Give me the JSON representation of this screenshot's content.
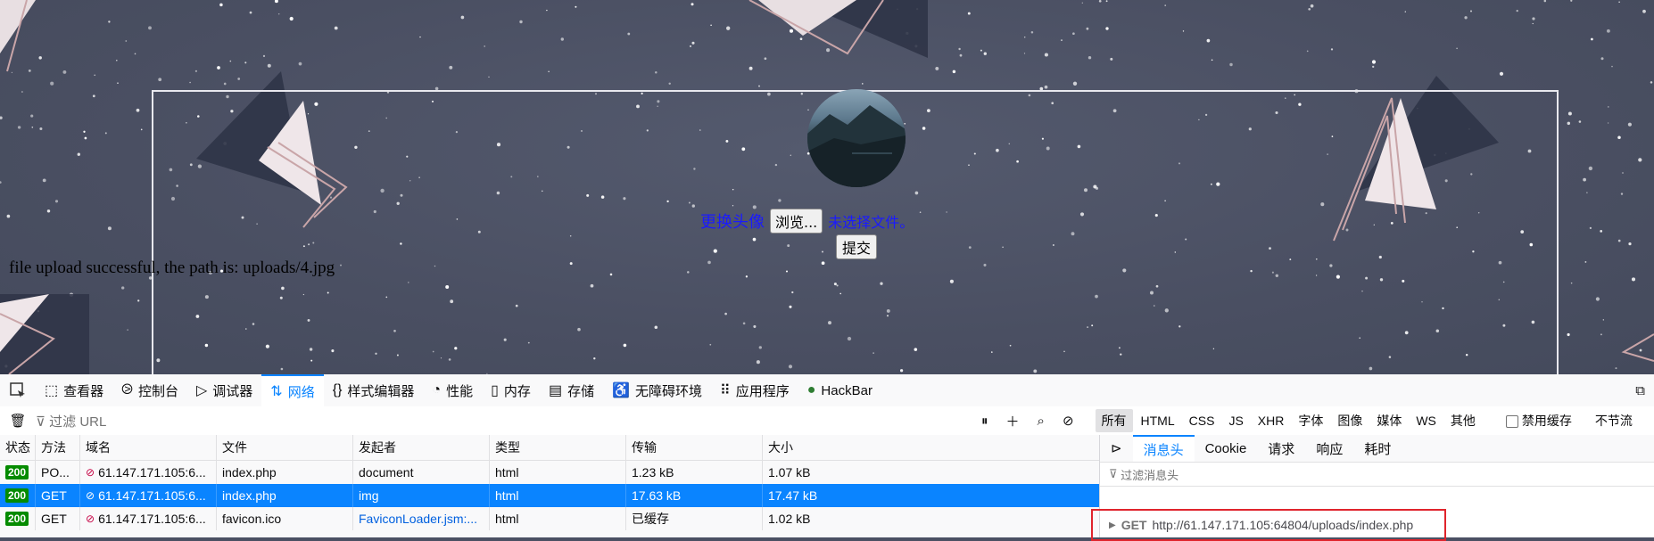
{
  "page": {
    "upload_label": "更换头像",
    "browse_button": "浏览...",
    "no_file_text": "未选择文件。",
    "submit_button": "提交",
    "status_message": "file upload successful, the path is: uploads/4.jpg"
  },
  "devtools": {
    "tabs": [
      {
        "label": "查看器",
        "icon": "inspector-icon"
      },
      {
        "label": "控制台",
        "icon": "console-icon"
      },
      {
        "label": "调试器",
        "icon": "debugger-icon"
      },
      {
        "label": "网络",
        "icon": "network-icon",
        "active": true
      },
      {
        "label": "样式编辑器",
        "icon": "style-editor-icon"
      },
      {
        "label": "性能",
        "icon": "performance-icon"
      },
      {
        "label": "内存",
        "icon": "memory-icon"
      },
      {
        "label": "存储",
        "icon": "storage-icon"
      },
      {
        "label": "无障碍环境",
        "icon": "accessibility-icon"
      },
      {
        "label": "应用程序",
        "icon": "application-icon"
      },
      {
        "label": "HackBar",
        "icon": "hackbar-icon"
      }
    ],
    "filter_placeholder": "过滤 URL",
    "type_filters": [
      "所有",
      "HTML",
      "CSS",
      "JS",
      "XHR",
      "字体",
      "图像",
      "媒体",
      "WS",
      "其他"
    ],
    "disable_cache": "禁用缓存",
    "throttle": "不节流",
    "columns": [
      "状态",
      "方法",
      "域名",
      "文件",
      "发起者",
      "类型",
      "传输",
      "大小"
    ],
    "rows": [
      {
        "status": "200",
        "method": "PO...",
        "domain": "61.147.171.105:6...",
        "file": "index.php",
        "initiator": "document",
        "type": "html",
        "transfer": "1.23 kB",
        "size": "1.07 kB"
      },
      {
        "status": "200",
        "method": "GET",
        "domain": "61.147.171.105:6...",
        "file": "index.php",
        "initiator": "img",
        "type": "html",
        "transfer": "17.63 kB",
        "size": "17.47 kB",
        "selected": true
      },
      {
        "status": "200",
        "method": "GET",
        "domain": "61.147.171.105:6...",
        "file": "favicon.ico",
        "initiator": "FaviconLoader.jsm:...",
        "type": "html",
        "transfer": "已缓存",
        "size": "1.02 kB"
      }
    ],
    "details": {
      "tabs": [
        "消息头",
        "Cookie",
        "请求",
        "响应",
        "耗时"
      ],
      "filter_placeholder": "过滤消息头",
      "method": "GET",
      "url": "http://61.147.171.105:64804/uploads/index.php"
    }
  },
  "colors": {
    "accent": "#0a84ff",
    "status_ok": "#058b00",
    "highlight_box": "#e0242c",
    "link": "#1a1aff"
  }
}
